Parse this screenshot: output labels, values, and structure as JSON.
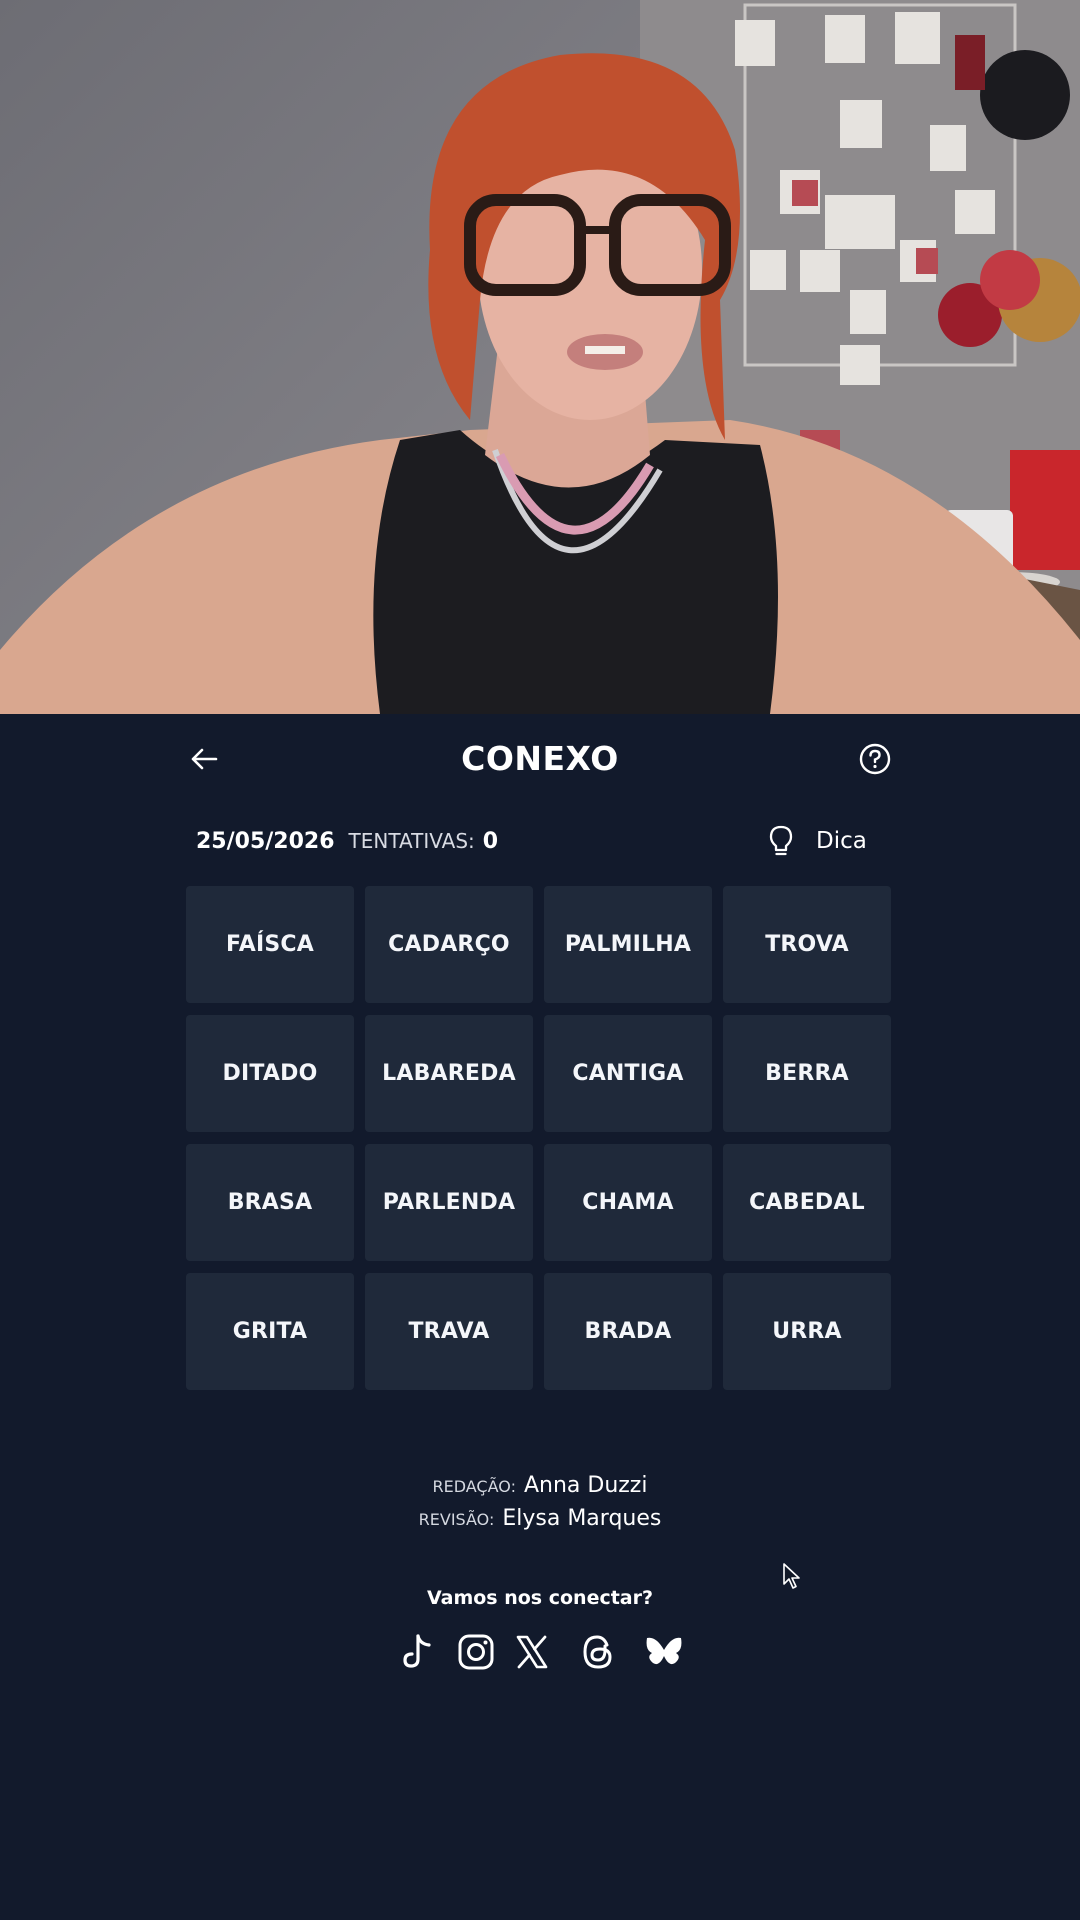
{
  "webcam": {
    "description_icon": "webcam-person-icon"
  },
  "header": {
    "title": "CONEXO",
    "back_icon": "arrow-left-icon",
    "help_icon": "question-circle-icon"
  },
  "stats": {
    "date": "25/05/2026",
    "attempts_label": "TENTATIVAS:",
    "attempts_value": "0"
  },
  "hint": {
    "label": "Dica",
    "icon": "lightbulb-icon"
  },
  "grid": {
    "tiles": [
      "FAÍSCA",
      "CADARÇO",
      "PALMILHA",
      "TROVA",
      "DITADO",
      "LABAREDA",
      "CANTIGA",
      "BERRA",
      "BRASA",
      "PARLENDA",
      "CHAMA",
      "CABEDAL",
      "GRITA",
      "TRAVA",
      "BRADA",
      "URRA"
    ]
  },
  "credits": {
    "editor_label": "REDAÇÃO:",
    "editor_name": "Anna Duzzi",
    "reviewer_label": "REVISÃO:",
    "reviewer_name": "Elysa Marques"
  },
  "social": {
    "prompt": "Vamos nos conectar?",
    "icons": [
      "tiktok-icon",
      "instagram-icon",
      "x-icon",
      "threads-icon",
      "bluesky-icon"
    ]
  },
  "colors": {
    "background": "#121a2c",
    "tile": "#1f293a",
    "text": "#ffffff"
  }
}
